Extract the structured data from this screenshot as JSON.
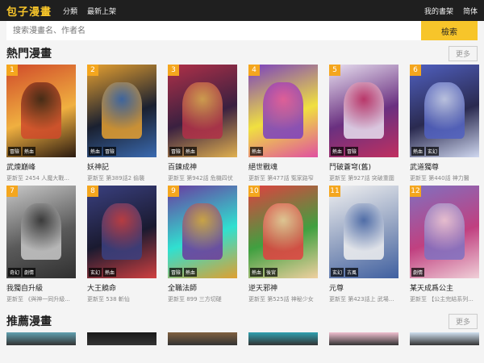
{
  "topbar": {
    "logo": "包子漫畫",
    "nav": [
      "分類",
      "最新上架"
    ],
    "right": [
      "我的書架",
      "简体"
    ]
  },
  "search": {
    "placeholder": "搜索漫畫名、作者名",
    "button": "檢索"
  },
  "hot": {
    "title": "熱門漫畫",
    "more": "更多",
    "items": [
      {
        "rank": "1",
        "title": "武煉巔峰",
        "update": "更新至 2454 人魔大戰...",
        "tags": [
          "冒險",
          "熱血"
        ],
        "colors": [
          "#d04a2a",
          "#2a1a10",
          "#f0b040"
        ]
      },
      {
        "rank": "2",
        "title": "妖神記",
        "update": "更新至 第389話2 偷襲",
        "tags": [
          "熱血",
          "冒險"
        ],
        "colors": [
          "#e6a030",
          "#3a6ab0",
          "#1a2030"
        ]
      },
      {
        "rank": "3",
        "title": "百鍊成神",
        "update": "更新至 第942話 危機四伏",
        "tags": [
          "冒險",
          "熱血"
        ],
        "colors": [
          "#b03048",
          "#e0b050",
          "#3a2040"
        ]
      },
      {
        "rank": "4",
        "title": "絕世戰魂",
        "update": "更新至 第477話 冤家路窄",
        "tags": [
          "熱血"
        ],
        "colors": [
          "#7a40c0",
          "#e050a0",
          "#f0e040"
        ]
      },
      {
        "rank": "5",
        "title": "鬥破蒼穹(舊)",
        "update": "更新至 第927話 突破重圍",
        "tags": [
          "熱血",
          "冒險"
        ],
        "colors": [
          "#e8e0f0",
          "#c03060",
          "#6a3080"
        ]
      },
      {
        "rank": "6",
        "title": "武道獨尊",
        "update": "更新至 第440話 神力醫",
        "tags": [
          "熱血",
          "玄幻"
        ],
        "colors": [
          "#5060c0",
          "#d0d8f0",
          "#2a2a50"
        ]
      },
      {
        "rank": "7",
        "title": "我獨自升級",
        "update": "更新至 《與神一同升級...",
        "tags": [
          "奇幻",
          "劇情"
        ],
        "colors": [
          "#c8c8c8",
          "#303030",
          "#5a5a5a"
        ]
      },
      {
        "rank": "8",
        "title": "大王饒命",
        "update": "更新至 538 斬仙",
        "tags": [
          "玄幻",
          "熱血"
        ],
        "colors": [
          "#3a4080",
          "#d04040",
          "#1a1a30"
        ]
      },
      {
        "rank": "9",
        "title": "全職法師",
        "update": "更新至 899 三方切磋",
        "tags": [
          "冒險",
          "熱血"
        ],
        "colors": [
          "#6a3aa0",
          "#e0a030",
          "#30e0d0"
        ]
      },
      {
        "rank": "10",
        "title": "逆天邪神",
        "update": "更新至 第525話 神秘少女",
        "tags": [
          "熱血",
          "後宮"
        ],
        "colors": [
          "#e04040",
          "#f0d0a0",
          "#40a040"
        ]
      },
      {
        "rank": "11",
        "title": "元尊",
        "update": "更新至 第423話上 武場...",
        "tags": [
          "玄幻",
          "古風"
        ],
        "colors": [
          "#f0f0f0",
          "#4060a0",
          "#90a0c0"
        ]
      },
      {
        "rank": "12",
        "title": "某天成爲公主",
        "update": "更新至 【公主完結系列...",
        "tags": [
          "劇情"
        ],
        "colors": [
          "#8070c0",
          "#f0d0d8",
          "#c04080"
        ]
      }
    ]
  },
  "recommend": {
    "title": "推薦漫畫",
    "more": "更多",
    "colors": [
      "#60a0b0",
      "#1a1a1a",
      "#806040",
      "#30a0b0",
      "#f0c0d0",
      "#d0e0f0"
    ]
  }
}
